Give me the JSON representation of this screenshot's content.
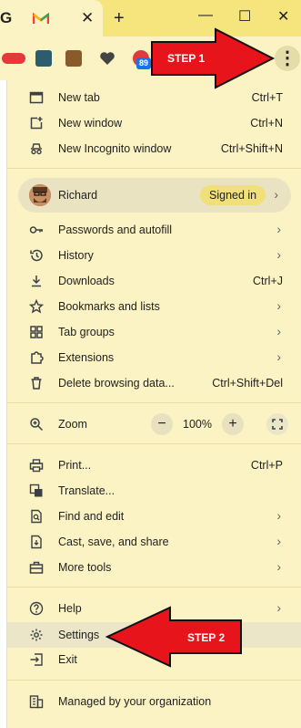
{
  "tab": {
    "title_letter": "G",
    "close": "✕",
    "new_tab": "+"
  },
  "window": {
    "minimize": "—",
    "maximize": "☐",
    "close": "✕"
  },
  "toolbar": {
    "badge_count": "89",
    "more_label": "⋮"
  },
  "annotations": {
    "step1": "STEP 1",
    "step2": "STEP 2",
    "arrow_color": "#e8141c"
  },
  "menu": {
    "new_tab": {
      "label": "New tab",
      "shortcut": "Ctrl+T"
    },
    "new_window": {
      "label": "New window",
      "shortcut": "Ctrl+N"
    },
    "incognito": {
      "label": "New Incognito window",
      "shortcut": "Ctrl+Shift+N"
    },
    "profile": {
      "name": "Richard",
      "status": "Signed in"
    },
    "passwords": {
      "label": "Passwords and autofill"
    },
    "history": {
      "label": "History"
    },
    "downloads": {
      "label": "Downloads",
      "shortcut": "Ctrl+J"
    },
    "bookmarks": {
      "label": "Bookmarks and lists"
    },
    "tab_groups": {
      "label": "Tab groups"
    },
    "extensions": {
      "label": "Extensions"
    },
    "delete_data": {
      "label": "Delete browsing data...",
      "shortcut": "Ctrl+Shift+Del"
    },
    "zoom": {
      "label": "Zoom",
      "minus": "−",
      "value": "100%",
      "plus": "+"
    },
    "print": {
      "label": "Print...",
      "shortcut": "Ctrl+P"
    },
    "translate": {
      "label": "Translate..."
    },
    "find_edit": {
      "label": "Find and edit"
    },
    "cast": {
      "label": "Cast, save, and share"
    },
    "more_tools": {
      "label": "More tools"
    },
    "help": {
      "label": "Help"
    },
    "settings": {
      "label": "Settings"
    },
    "exit": {
      "label": "Exit"
    },
    "managed": {
      "label": "Managed by your organization"
    }
  }
}
